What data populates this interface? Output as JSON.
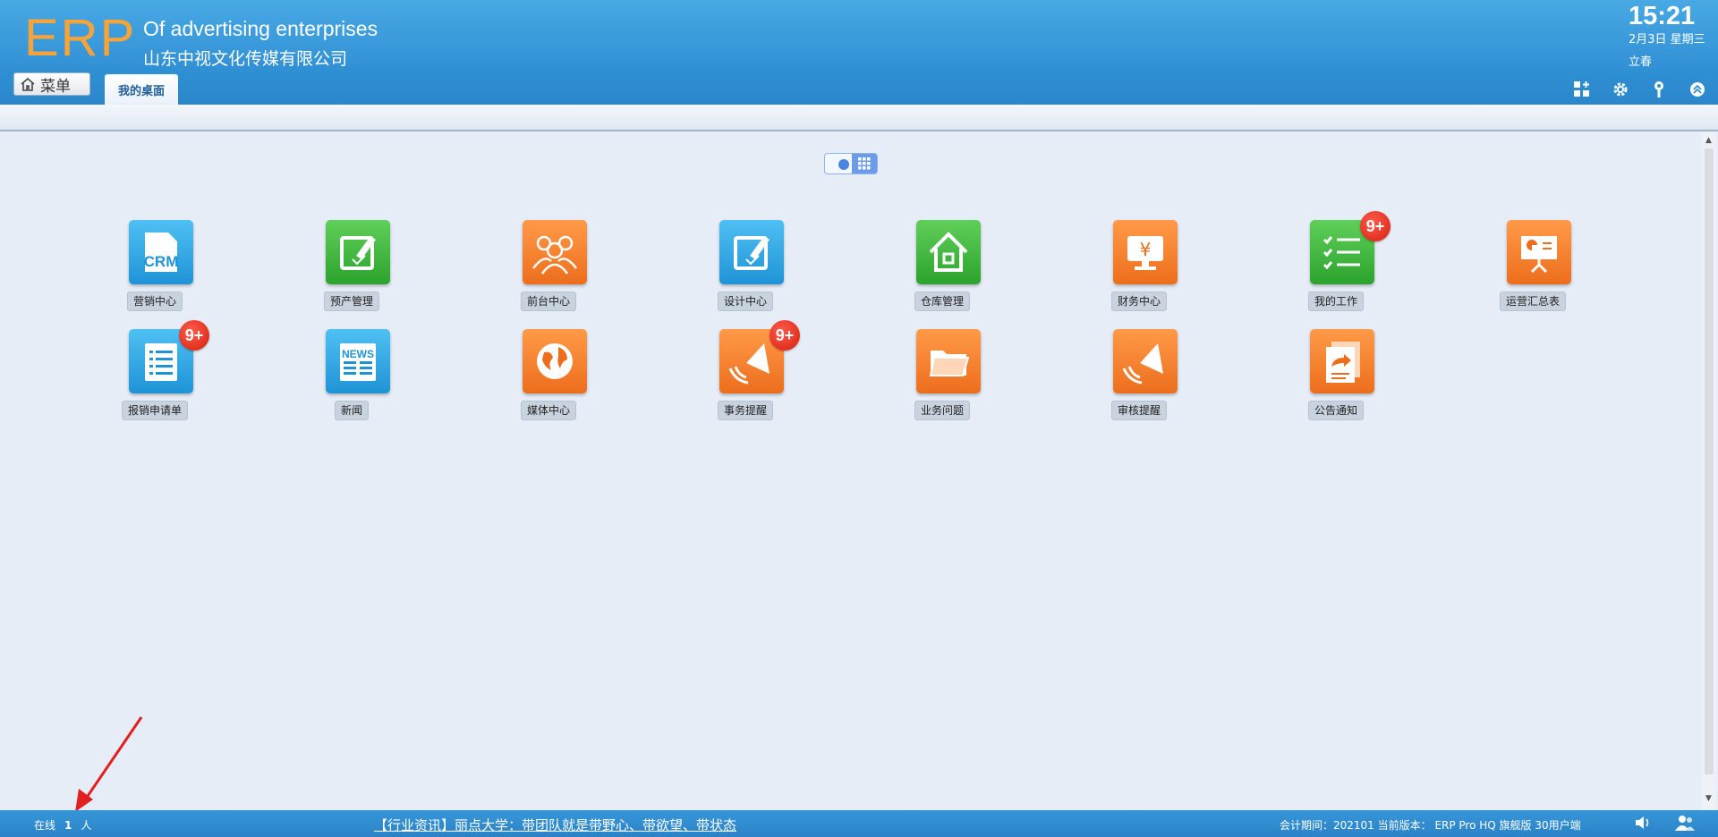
{
  "header": {
    "logo": "ERP",
    "subtitle_en": "Of advertising enterprises",
    "company": "山东中视文化传媒有限公司",
    "time": "15:21",
    "date": "2月3日 星期三",
    "solar_term": "立春",
    "menu_label": "菜单",
    "tab_label": "我的桌面",
    "icons": [
      "grid-add-icon",
      "gear-icon",
      "key-icon",
      "collapse-icon"
    ]
  },
  "desktop": {
    "row1": [
      {
        "label": "营销中心",
        "color": "blue",
        "icon": "crm-icon"
      },
      {
        "label": "预产管理",
        "color": "green",
        "icon": "edit-check-icon"
      },
      {
        "label": "前台中心",
        "color": "orange",
        "icon": "people-icon"
      },
      {
        "label": "设计中心",
        "color": "blue",
        "icon": "edit-check-icon"
      },
      {
        "label": "仓库管理",
        "color": "green",
        "icon": "house-icon"
      },
      {
        "label": "财务中心",
        "color": "orange",
        "icon": "yen-monitor-icon"
      },
      {
        "label": "我的工作",
        "color": "green",
        "icon": "checklist-icon",
        "badge": "9+"
      },
      {
        "label": "运营汇总表",
        "color": "orange",
        "icon": "presentation-icon"
      }
    ],
    "row2": [
      {
        "label": "报销申请单",
        "color": "blue",
        "icon": "list-icon",
        "badge": "9+"
      },
      {
        "label": "新闻",
        "color": "blue",
        "icon": "news-icon"
      },
      {
        "label": "媒体中心",
        "color": "orange",
        "icon": "globe-icon"
      },
      {
        "label": "事务提醒",
        "color": "orange",
        "icon": "megaphone-icon",
        "badge": "9+"
      },
      {
        "label": "业务问题",
        "color": "orange",
        "icon": "folder-icon"
      },
      {
        "label": "审核提醒",
        "color": "orange",
        "icon": "megaphone-icon"
      },
      {
        "label": "公告通知",
        "color": "orange",
        "icon": "share-doc-icon"
      }
    ]
  },
  "statusbar": {
    "online_prefix": "在线",
    "online_count": "1",
    "online_suffix": "人",
    "news": "【行业资讯】丽点大学：带团队就是带野心、带欲望、带状态",
    "version": "会计期间：202101 当前版本：  ERP Pro HQ 旗舰版 30用户端"
  },
  "colors": {
    "header_blue": "#2f8fd3",
    "logo_orange": "#f6a33a",
    "badge_red": "#d4200f"
  }
}
